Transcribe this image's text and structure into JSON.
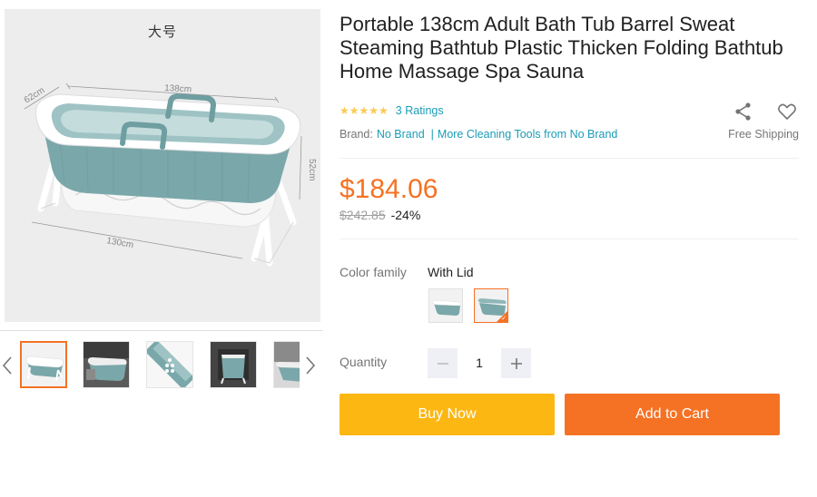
{
  "gallery": {
    "main_image": {
      "size_tag": "大号",
      "dim_width": "138cm",
      "dim_depth": "62cm",
      "dim_height": "52cm",
      "dim_base": "130cm",
      "image_semantic": "foldable-bathtub-product-photo"
    },
    "thumbnails": [
      {
        "semantic": "bathtub-side-view",
        "active": true
      },
      {
        "semantic": "bathtub-in-bathroom",
        "active": false
      },
      {
        "semantic": "bathtub-top-view-drain",
        "active": false
      },
      {
        "semantic": "bathtub-folded-view",
        "active": false
      },
      {
        "semantic": "bathtub-partial-view",
        "active": false
      }
    ],
    "prev_icon": "chevron-left-icon",
    "next_icon": "chevron-right-icon"
  },
  "product": {
    "title": "Portable 138cm Adult Bath Tub Barrel Sweat Steaming Bathtub Plastic Thicken Folding Bathtub Home Massage Spa Sauna",
    "rating_stars": 5,
    "ratings_text": "3 Ratings",
    "brand_label": "Brand:",
    "brand_name": "No Brand",
    "brand_more": "More Cleaning Tools from No Brand",
    "free_shipping": "Free Shipping",
    "price": "$184.06",
    "old_price": "$242.85",
    "discount": "-24%"
  },
  "variant": {
    "label": "Color family",
    "selected": "With Lid",
    "options": [
      "Without Lid",
      "With Lid"
    ],
    "selected_index": 1
  },
  "quantity": {
    "label": "Quantity",
    "value": "1",
    "minus_icon": "minus-icon",
    "plus_icon": "plus-icon"
  },
  "actions": {
    "buy_now": "Buy Now",
    "add_to_cart": "Add to Cart"
  },
  "colors": {
    "accent": "#f57224",
    "buy_now_bg": "#fdb712",
    "link": "#1a9cb7",
    "star": "#faca51",
    "tub_teal": "#6f9ea1"
  }
}
